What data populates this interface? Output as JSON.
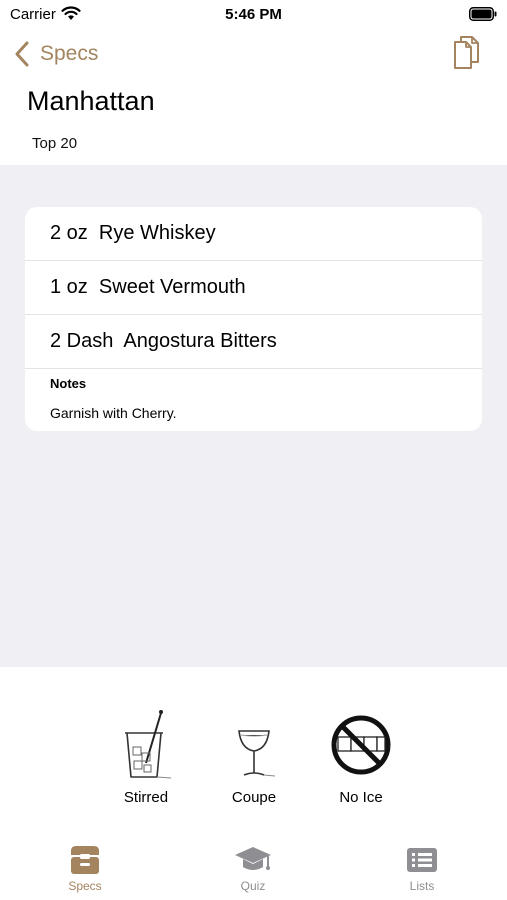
{
  "status_bar": {
    "carrier": "Carrier",
    "time": "5:46 PM"
  },
  "nav": {
    "back_label": "Specs",
    "copy_icon": "copy-icon"
  },
  "page": {
    "title": "Manhattan",
    "subtitle": "Top 20"
  },
  "ingredients": [
    {
      "text": "2 oz  Rye Whiskey"
    },
    {
      "text": "1 oz  Sweet Vermouth"
    },
    {
      "text": "2 Dash  Angostura Bitters"
    }
  ],
  "notes": {
    "title": "Notes",
    "text": "Garnish with Cherry."
  },
  "methods": [
    {
      "label": "Stirred",
      "icon": "mixing-glass-icon"
    },
    {
      "label": "Coupe",
      "icon": "coupe-glass-icon"
    },
    {
      "label": "No Ice",
      "icon": "no-ice-icon"
    }
  ],
  "tabs": [
    {
      "label": "Specs",
      "icon": "specs-box-icon",
      "active": true
    },
    {
      "label": "Quiz",
      "icon": "graduation-cap-icon",
      "active": false
    },
    {
      "label": "Lists",
      "icon": "list-icon",
      "active": false
    }
  ],
  "colors": {
    "accent": "#a3845f",
    "inactive": "#8e8e93",
    "background": "#efeff4"
  }
}
